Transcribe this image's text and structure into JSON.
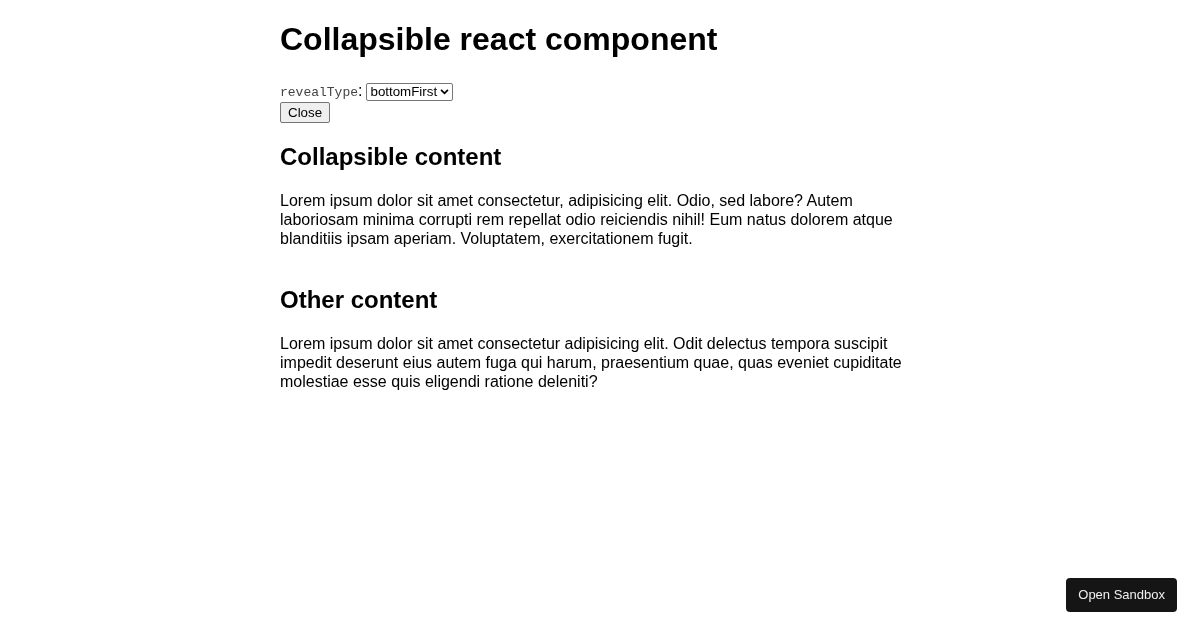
{
  "title": "Collapsible react component",
  "controls": {
    "reveal_type": {
      "label": "revealType",
      "suffix": ":",
      "value": "bottomFirst"
    },
    "toggle_button": "Close"
  },
  "sections": [
    {
      "heading": "Collapsible content",
      "body": "Lorem ipsum dolor sit amet consectetur, adipisicing elit. Odio, sed labore? Autem laboriosam minima corrupti rem repellat odio reiciendis nihil! Eum natus dolorem atque blanditiis ipsam aperiam. Voluptatem, exercitationem fugit."
    },
    {
      "heading": "Other content",
      "body": "Lorem ipsum dolor sit amet consectetur adipisicing elit. Odit delectus tempora suscipit impedit deserunt eius autem fuga qui harum, praesentium quae, quas eveniet cupiditate molestiae esse quis eligendi ratione deleniti?"
    }
  ],
  "sandbox_button": "Open Sandbox"
}
